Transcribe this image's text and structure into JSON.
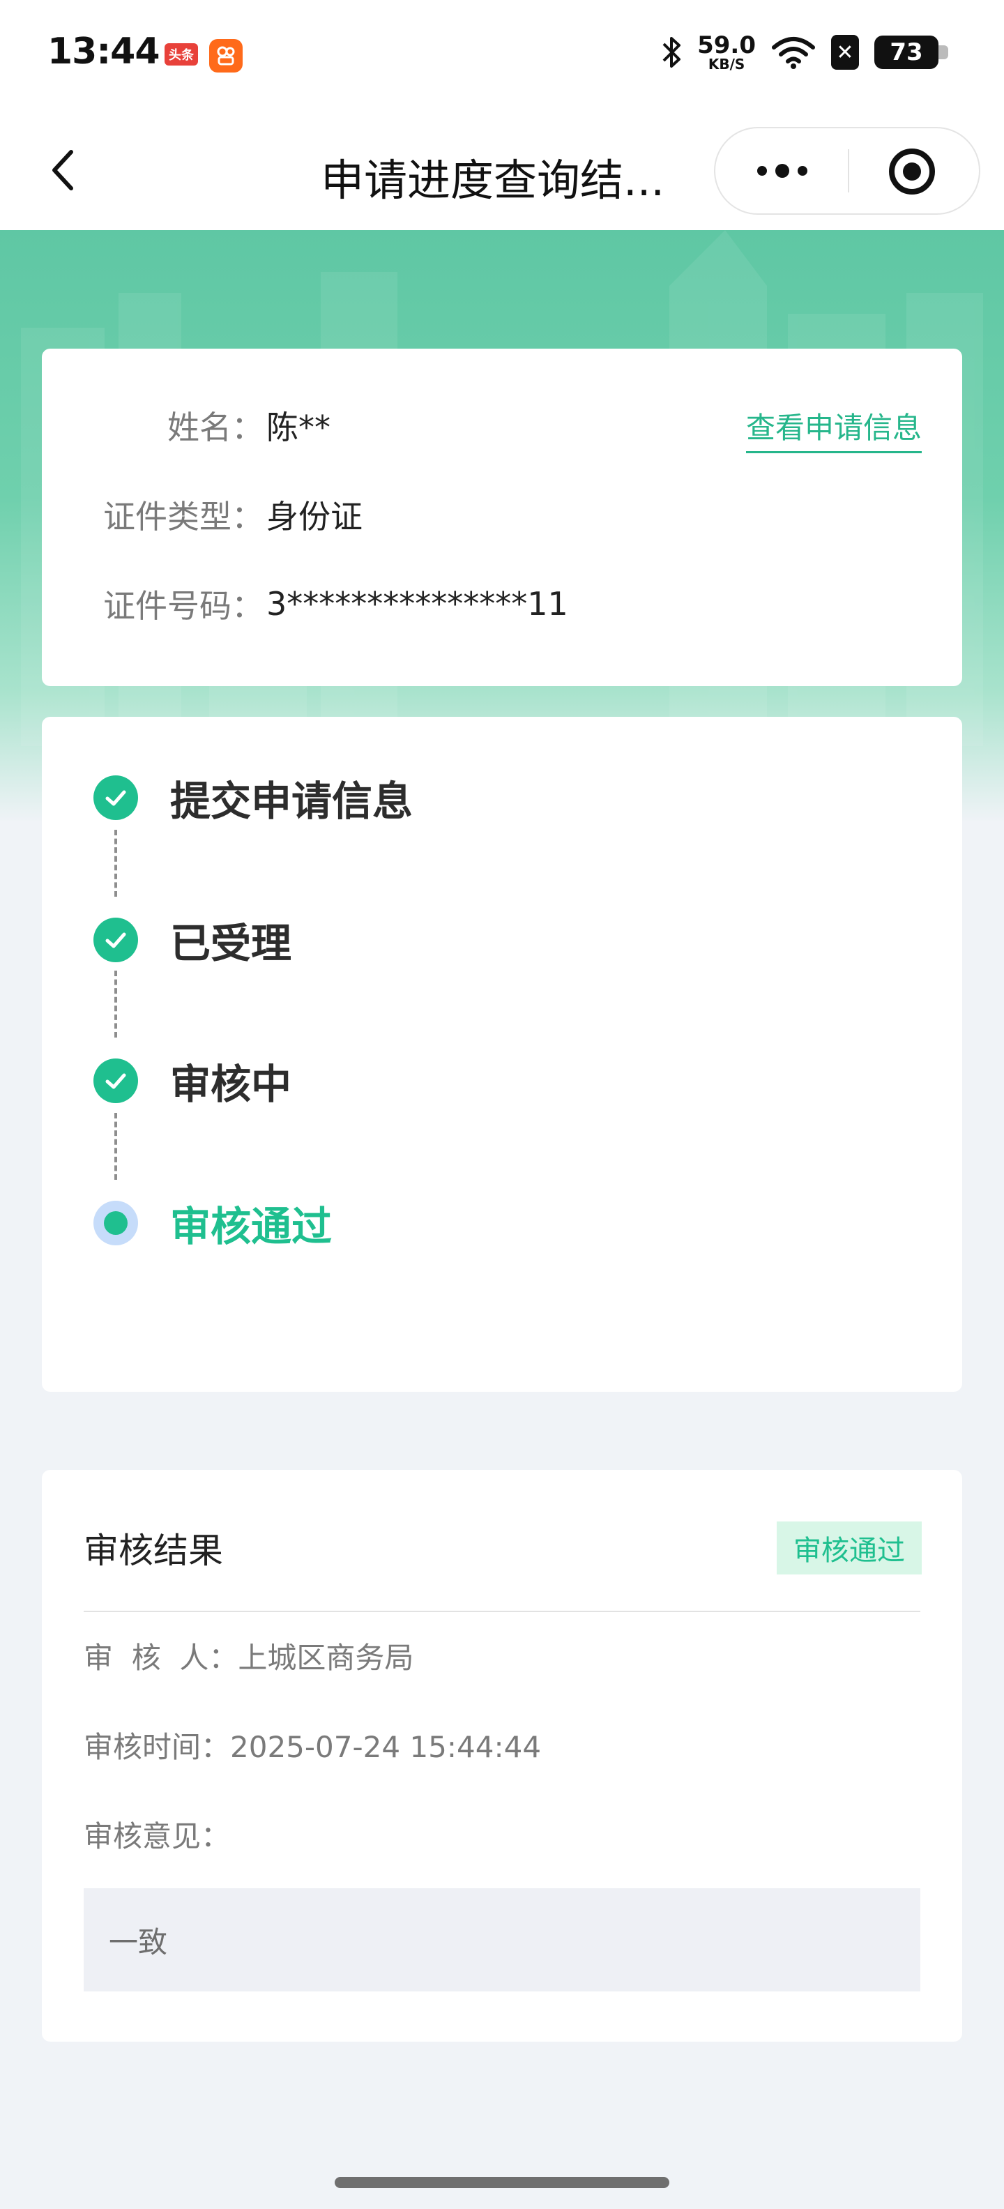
{
  "status_bar": {
    "time": "13:44",
    "app_badge_1": "头条",
    "app_badge_2": "",
    "net_speed": "59.0",
    "net_unit": "KB/S",
    "battery": "73",
    "icons": [
      "toutiao-app-icon",
      "kuaishou-app-icon",
      "bluetooth-icon",
      "wifi-icon",
      "sim-off-icon",
      "battery-icon"
    ]
  },
  "nav": {
    "title": "申请进度查询结..."
  },
  "colors": {
    "accent": "#1fbf8f",
    "header_green": "#5fc7a4",
    "badge_bg": "#d8f6e7",
    "current_ring": "#c6dcfa"
  },
  "info": {
    "view_link": "查看申请信息",
    "rows": [
      {
        "label": "姓名：",
        "value": "陈**"
      },
      {
        "label": "证件类型：",
        "value": "身份证"
      },
      {
        "label": "证件号码：",
        "value": "3***************11"
      }
    ]
  },
  "progress": {
    "steps": [
      {
        "label": "提交申请信息",
        "status": "done"
      },
      {
        "label": "已受理",
        "status": "done"
      },
      {
        "label": "审核中",
        "status": "done"
      },
      {
        "label": "审核通过",
        "status": "current"
      }
    ]
  },
  "result": {
    "title": "审核结果",
    "badge": "审核通过",
    "reviewer_label": "审  核  人：",
    "reviewer_value": "上城区商务局",
    "time_label": "审核时间：",
    "time_value": "2025-07-24 15:44:44",
    "opinion_label": "审核意见：",
    "opinion_value": "一致"
  }
}
